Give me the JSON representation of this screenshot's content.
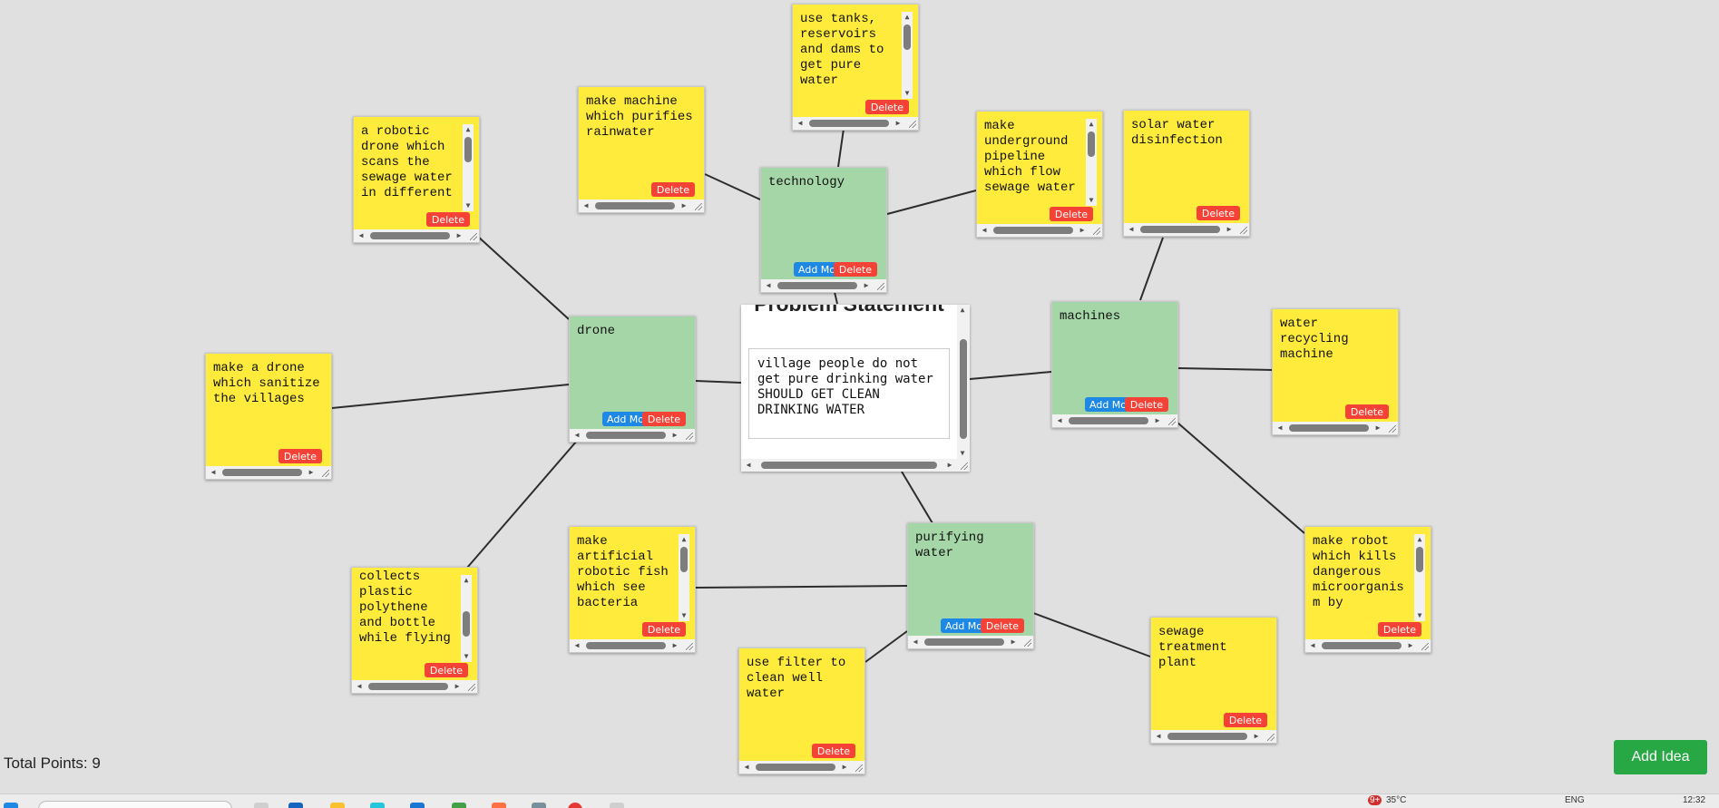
{
  "problem": {
    "title": "Problem Statement",
    "text": "village people do not get pure drinking water\nSHOULD GET CLEAN DRINKING WATER"
  },
  "categories": {
    "technology": "technology",
    "drone": "drone",
    "machines": "machines",
    "purifying": "purifying water"
  },
  "ideas": {
    "tanks": "use tanks, reservoirs and dams to get pure water",
    "rainwater": "make machine which purifies rainwater",
    "pipeline": "make underground pipeline which flow sewage water",
    "solar": "solar water disinfection",
    "robotic_drone": "a robotic drone which scans the sewage water in different",
    "sanitize": "make a drone which sanitize the villages",
    "plastic": "collects plastic polythene and bottle while flying",
    "fish": "make artificial robotic fish which see bacteria",
    "filter": "use filter to clean well water",
    "sewage_plant": "sewage treatment plant",
    "robot": "make robot which kills dangerous microorganism by",
    "recycling": "water recycling machine"
  },
  "buttons": {
    "delete": "Delete",
    "add_more": "Add More",
    "add_idea": "Add Idea"
  },
  "footer": {
    "total_points": "Total Points: 9"
  },
  "taskbar": {
    "weather": "35°C",
    "language": "ENG",
    "time": "12:32",
    "notif_badge": "9+"
  },
  "colors": {
    "idea_note": "#ffeb3b",
    "category_note": "#a5d6a7",
    "delete_button": "#f44336",
    "add_more_button": "#1e88e5",
    "add_idea_button": "#28a745",
    "background": "#e0e0e0"
  }
}
